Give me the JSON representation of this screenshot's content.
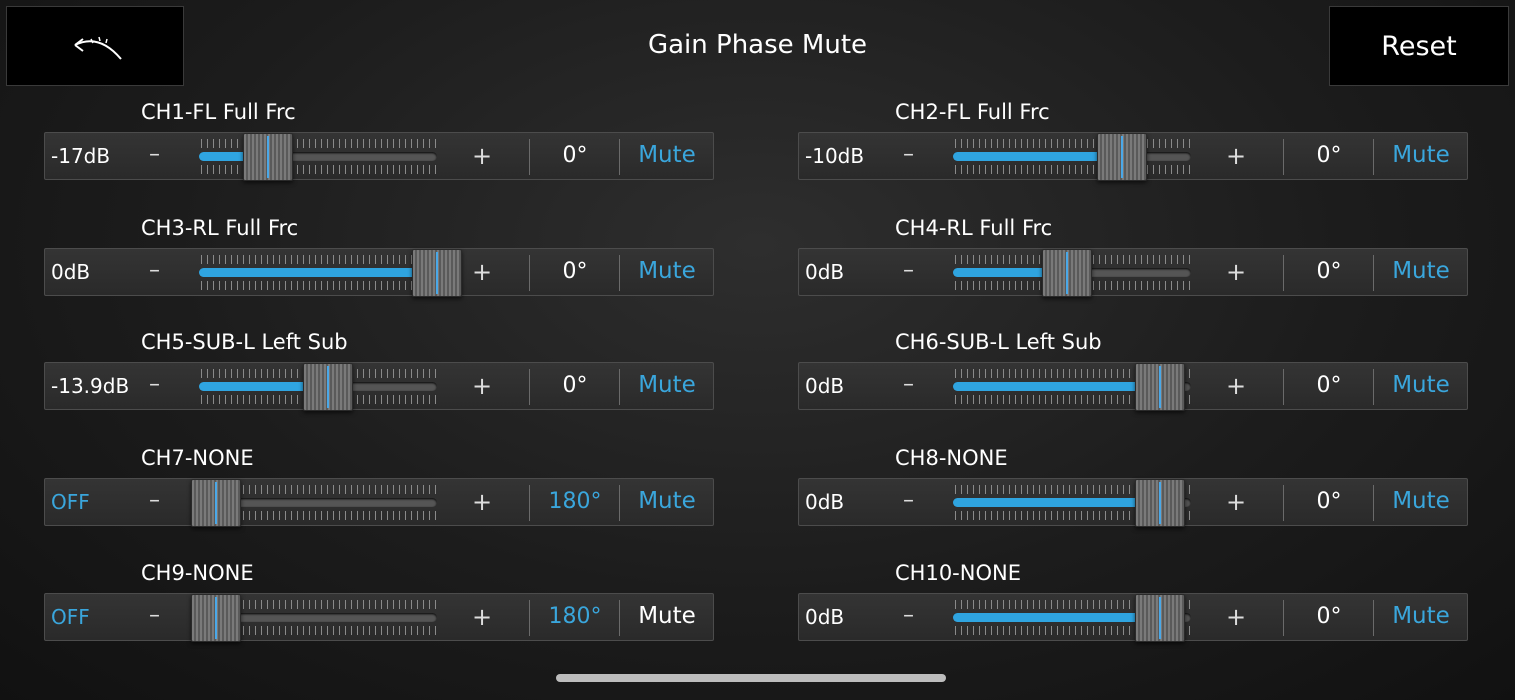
{
  "header": {
    "title": "Gain Phase Mute",
    "reset_label": "Reset",
    "back_icon": "back-arrow-icon"
  },
  "colors": {
    "accent": "#3aa6dc",
    "fill": "#2fa4e0"
  },
  "channels": [
    {
      "name": "CH1-FL Full Frc",
      "gain": "-17dB",
      "gain_accent": false,
      "level": 0.29,
      "phase": "0°",
      "phase_accent": false,
      "mute": "Mute",
      "mute_on": true
    },
    {
      "name": "CH2-FL Full Frc",
      "gain": "-10dB",
      "gain_accent": false,
      "level": 0.71,
      "phase": "0°",
      "phase_accent": false,
      "mute": "Mute",
      "mute_on": true
    },
    {
      "name": "CH3-RL Full Frc",
      "gain": "0dB",
      "gain_accent": false,
      "level": 1.0,
      "phase": "0°",
      "phase_accent": false,
      "mute": "Mute",
      "mute_on": true
    },
    {
      "name": "CH4-RL Full Frc",
      "gain": "0dB",
      "gain_accent": false,
      "level": 0.48,
      "phase": "0°",
      "phase_accent": false,
      "mute": "Mute",
      "mute_on": true
    },
    {
      "name": "CH5-SUB-L Left Sub",
      "gain": "-13.9dB",
      "gain_accent": false,
      "level": 0.54,
      "phase": "0°",
      "phase_accent": false,
      "mute": "Mute",
      "mute_on": true
    },
    {
      "name": "CH6-SUB-L Left Sub",
      "gain": "0dB",
      "gain_accent": false,
      "level": 0.87,
      "phase": "0°",
      "phase_accent": false,
      "mute": "Mute",
      "mute_on": true
    },
    {
      "name": "CH7-NONE",
      "gain": "OFF",
      "gain_accent": true,
      "level": 0.07,
      "phase": "180°",
      "phase_accent": true,
      "mute": "Mute",
      "mute_on": true
    },
    {
      "name": "CH8-NONE",
      "gain": "0dB",
      "gain_accent": false,
      "level": 0.87,
      "phase": "0°",
      "phase_accent": false,
      "mute": "Mute",
      "mute_on": true
    },
    {
      "name": "CH9-NONE",
      "gain": "OFF",
      "gain_accent": true,
      "level": 0.07,
      "phase": "180°",
      "phase_accent": true,
      "mute": "Mute",
      "mute_on": false
    },
    {
      "name": "CH10-NONE",
      "gain": "0dB",
      "gain_accent": false,
      "level": 0.87,
      "phase": "0°",
      "phase_accent": false,
      "mute": "Mute",
      "mute_on": true
    }
  ],
  "controls": {
    "minus": "–",
    "plus": "+"
  }
}
